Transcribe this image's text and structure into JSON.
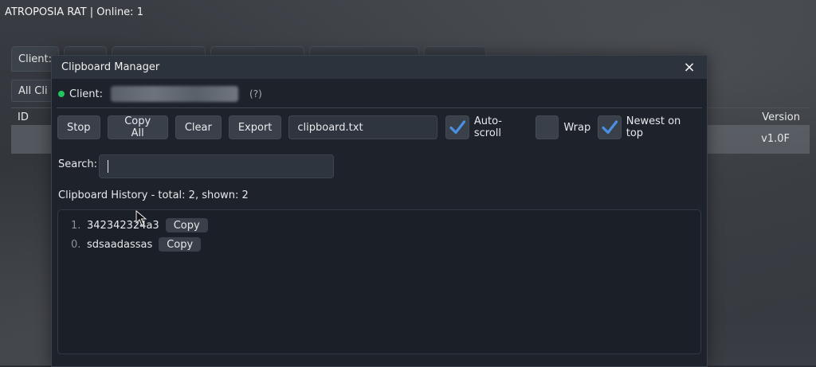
{
  "app": {
    "title": "ATROPOSIA RAT | Online: 1"
  },
  "background": {
    "tab_clients": "Client:",
    "filter": "All Cli",
    "col_id": "ID",
    "col_version": "Version",
    "row_version": "v1.0F"
  },
  "dialog": {
    "title": "Clipboard Manager",
    "close_icon": "×",
    "client_label": "Client:",
    "help": "(?)"
  },
  "toolbar": {
    "stop": "Stop",
    "copy_all": "Copy All",
    "clear": "Clear",
    "export": "Export",
    "filename": "clipboard.txt",
    "auto_scroll": {
      "label": "Auto-scroll",
      "checked": true
    },
    "wrap": {
      "label": "Wrap",
      "checked": false
    },
    "newest_on_top": {
      "label": "Newest on top",
      "checked": true
    }
  },
  "search": {
    "label": "Search:",
    "value": ""
  },
  "history": {
    "summary": "Clipboard History - total: 2, shown: 2",
    "copy_label": "Copy",
    "items": [
      {
        "num": "1.",
        "text": "342342324a3"
      },
      {
        "num": "0.",
        "text": "sdsaadassas"
      }
    ]
  },
  "colors": {
    "accent": "#4a90e2",
    "status_online": "#22c55e"
  }
}
